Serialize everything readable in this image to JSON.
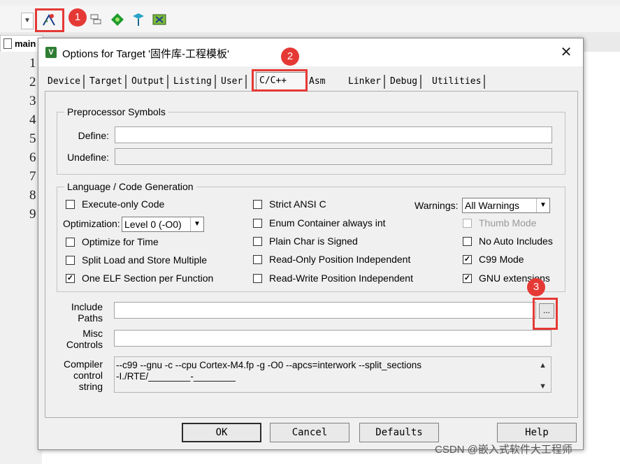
{
  "ide": {
    "editor_tab_label": "main",
    "line_numbers": [
      "1",
      "2",
      "3",
      "4",
      "5",
      "6",
      "7",
      "8",
      "9"
    ],
    "toolbar_icons": [
      "options-for-target-icon",
      "batch-setup-icon",
      "manage-components-icon",
      "select-packs-icon",
      "pack-installer-icon"
    ]
  },
  "annotations": {
    "step1": "1",
    "step2": "2",
    "step3": "3"
  },
  "dialog": {
    "title": "Options for Target '固件库-工程模板'",
    "close_label": "✕",
    "tabs": [
      {
        "label": "Device"
      },
      {
        "label": "Target"
      },
      {
        "label": "Output"
      },
      {
        "label": "Listing"
      },
      {
        "label": "User"
      },
      {
        "label": "C/C++"
      },
      {
        "label": "Asm"
      },
      {
        "label": "Linker"
      },
      {
        "label": "Debug"
      },
      {
        "label": "Utilities"
      }
    ],
    "active_tab": "C/C++",
    "preprocessor": {
      "title": "Preprocessor Symbols",
      "define_label": "Define:",
      "define_value": "",
      "undefine_label": "Undefine:",
      "undefine_value": ""
    },
    "codegen": {
      "title": "Language / Code Generation",
      "execute_only": {
        "label": "Execute-only Code",
        "checked": false
      },
      "optimization_label": "Optimization:",
      "optimization_value": "Level 0 (-O0)",
      "optimize_time": {
        "label": "Optimize for Time",
        "checked": false
      },
      "split_load": {
        "label": "Split Load and Store Multiple",
        "checked": false
      },
      "one_elf": {
        "label": "One ELF Section per Function",
        "checked": true
      },
      "strict_ansi": {
        "label": "Strict ANSI C",
        "checked": false
      },
      "enum_container": {
        "label": "Enum Container always int",
        "checked": false
      },
      "plain_char": {
        "label": "Plain Char is Signed",
        "checked": false
      },
      "ro_pi": {
        "label": "Read-Only Position Independent",
        "checked": false
      },
      "rw_pi": {
        "label": "Read-Write Position Independent",
        "checked": false
      },
      "warnings_label": "Warnings:",
      "warnings_value": "All Warnings",
      "thumb_mode": {
        "label": "Thumb Mode",
        "checked": false
      },
      "no_auto_includes": {
        "label": "No Auto Includes",
        "checked": false
      },
      "c99_mode": {
        "label": "C99 Mode",
        "checked": true
      },
      "gnu_extensions": {
        "label": "GNU extensions",
        "checked": true
      }
    },
    "include_label_1": "Include",
    "include_label_2": "Paths",
    "include_value": "",
    "browse_label": "...",
    "misc_label_1": "Misc",
    "misc_label_2": "Controls",
    "misc_value": "",
    "compiler_label_1": "Compiler",
    "compiler_label_2": "control",
    "compiler_label_3": "string",
    "compiler_line_1": "--c99 --gnu -c --cpu Cortex-M4.fp -g -O0 --apcs=interwork --split_sections",
    "compiler_line_2": "-I./RTE/________-________",
    "buttons": {
      "ok": "OK",
      "cancel": "Cancel",
      "defaults": "Defaults",
      "help": "Help"
    }
  },
  "watermark": "CSDN @嵌入式软件大工程师"
}
